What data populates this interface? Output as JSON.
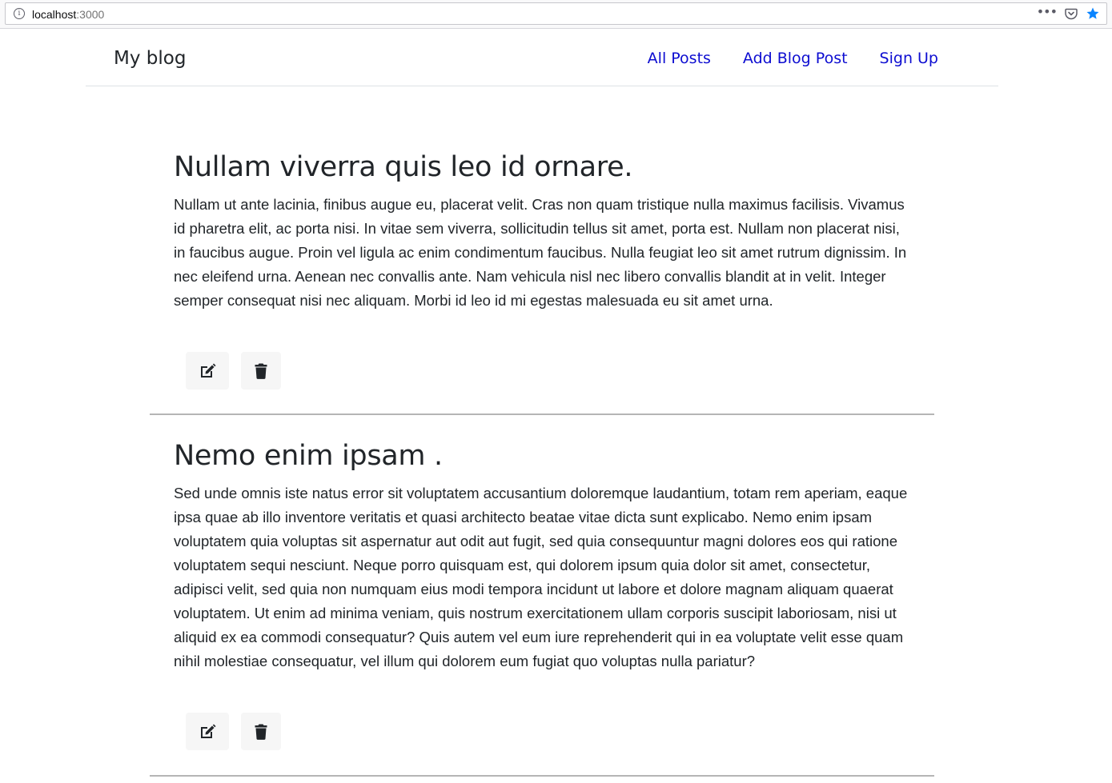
{
  "browser": {
    "url_host": "localhost",
    "url_port": ":3000",
    "info_glyph": "i",
    "menu_glyph": "•••"
  },
  "navbar": {
    "brand": "My blog",
    "links": [
      {
        "label": "All Posts"
      },
      {
        "label": "Add Blog Post"
      },
      {
        "label": "Sign Up"
      }
    ]
  },
  "posts": [
    {
      "title": "Nullam viverra quis leo id ornare.",
      "body": "Nullam ut ante lacinia, finibus augue eu, placerat velit. Cras non quam tristique nulla maximus facilisis. Vivamus id pharetra elit, ac porta nisi. In vitae sem viverra, sollicitudin tellus sit amet, porta est. Nullam non placerat nisi, in faucibus augue. Proin vel ligula ac enim condimentum faucibus. Nulla feugiat leo sit amet rutrum dignissim. In nec eleifend urna. Aenean nec convallis ante. Nam vehicula nisl nec libero convallis blandit at in velit. Integer semper consequat nisi nec aliquam. Morbi id leo id mi egestas malesuada eu sit amet urna."
    },
    {
      "title": "Nemo enim ipsam .",
      "body": "Sed unde omnis iste natus error sit voluptatem accusantium doloremque laudantium, totam rem aperiam, eaque ipsa quae ab illo inventore veritatis et quasi architecto beatae vitae dicta sunt explicabo. Nemo enim ipsam voluptatem quia voluptas sit aspernatur aut odit aut fugit, sed quia consequuntur magni dolores eos qui ratione voluptatem sequi nesciunt. Neque porro quisquam est, qui dolorem ipsum quia dolor sit amet, consectetur, adipisci velit, sed quia non numquam eius modi tempora incidunt ut labore et dolore magnam aliquam quaerat voluptatem. Ut enim ad minima veniam, quis nostrum exercitationem ullam corporis suscipit laboriosam, nisi ut aliquid ex ea commodi consequatur? Quis autem vel eum iure reprehenderit qui in ea voluptate velit esse quam nihil molestiae consequatur, vel illum qui dolorem eum fugiat quo voluptas nulla pariatur?"
    }
  ],
  "icons": {
    "edit": "edit-icon",
    "delete": "trash-icon",
    "pocket": "pocket-icon",
    "bookmark": "star-icon"
  },
  "colors": {
    "link": "#0d0dd1",
    "text": "#212529",
    "star": "#0a84ff",
    "button_bg": "#f6f6f6"
  }
}
